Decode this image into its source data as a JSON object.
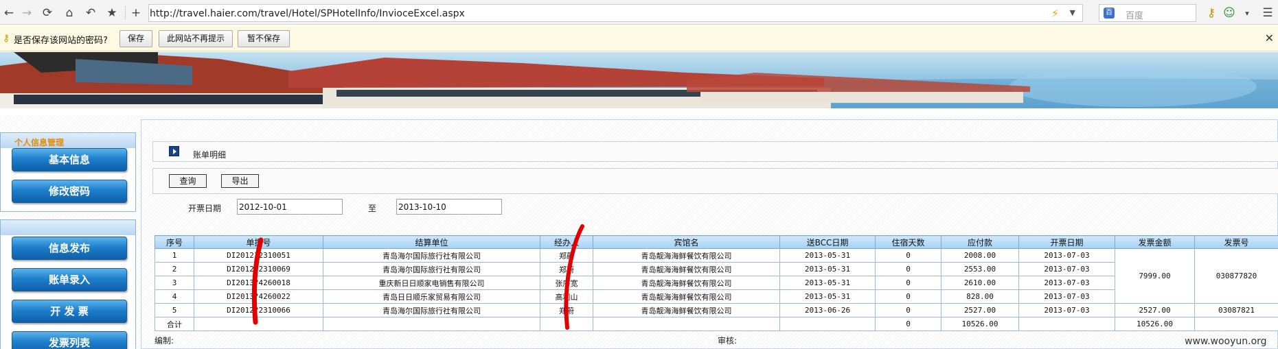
{
  "browser": {
    "url": "http://travel.haier.com/travel/Hotel/SPHotelInfo/InvioceExcel.aspx",
    "search_placeholder": "百度"
  },
  "password_bar": {
    "prompt": "是否保存该网站的密码?",
    "save": "保存",
    "never": "此网站不再提示",
    "not_now": "暂不保存"
  },
  "sidebar": {
    "section1_title": "个人信息管理",
    "section1_items": [
      "基本信息",
      "修改密码"
    ],
    "section2_items": [
      "信息发布",
      "账单录入",
      "开 发 票",
      "发票列表"
    ]
  },
  "content": {
    "title": "账单明细",
    "query_button": "查询",
    "export_button": "导出",
    "date_label": "开票日期",
    "date_from": "2012-10-01",
    "to_label": "至",
    "date_to": "2013-10-10"
  },
  "table": {
    "headers": [
      "序号",
      "单据号",
      "结算单位",
      "经办人",
      "宾馆名",
      "送BCC日期",
      "住宿天数",
      "应付款",
      "开票日期",
      "发票金额",
      "发票号"
    ],
    "rows": [
      [
        "1",
        "DI2012?2310051",
        "青岛海尔国际旅行社有限公司",
        "郑蔚",
        "青岛靓海海鲜餐饮有限公司",
        "2013-05-31",
        "0",
        "2008.00",
        "2013-07-03"
      ],
      [
        "2",
        "DI2012?2310069",
        "青岛海尔国际旅行社有限公司",
        "郑蔚",
        "青岛靓海海鲜餐饮有限公司",
        "2013-05-31",
        "0",
        "2553.00",
        "2013-07-03"
      ],
      [
        "3",
        "DI2013?4260018",
        "重庆新日日顺家电销售有限公司",
        "张序宽",
        "青岛靓海海鲜餐饮有限公司",
        "2013-05-31",
        "0",
        "2610.00",
        "2013-07-03"
      ],
      [
        "4",
        "DI2013?4260022",
        "青岛日日顺乐家贸易有限公司",
        "高利山",
        "青岛靓海海鲜餐饮有限公司",
        "2013-05-31",
        "0",
        "828.00",
        "2013-07-03"
      ],
      [
        "5",
        "DI2012?2310066",
        "青岛海尔国际旅行社有限公司",
        "郑蔚",
        "青岛靓海海鲜餐饮有限公司",
        "2013-06-26",
        "0",
        "2527.00",
        "2013-07-03"
      ]
    ],
    "group_invoice_amount": "7999.00",
    "group_invoice_no": "030877820",
    "row5_invoice_amount": "2527.00",
    "row5_invoice_no": "03087821",
    "total_label": "合计",
    "total_days": "0",
    "total_payable": "10526.00",
    "total_invoice": "10526.00"
  },
  "footer": {
    "editor_label": "编制:",
    "reviewer_label": "审核:"
  },
  "watermark": "www.wooyun.org"
}
